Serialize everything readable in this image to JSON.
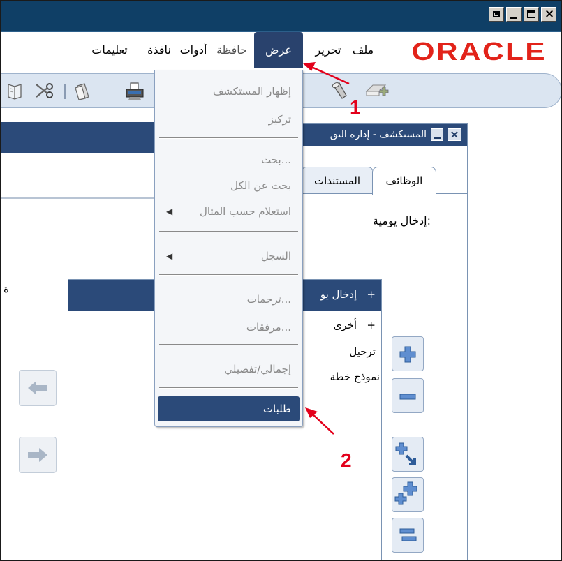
{
  "menubar": {
    "logo": "ORACLE",
    "items": [
      "ملف",
      "تحرير",
      "عرض",
      "حافظة",
      "أدوات",
      "نافذة",
      "تعليمات"
    ],
    "active": "عرض"
  },
  "dropdown": {
    "items": [
      {
        "label": "إظهار المستكشف"
      },
      {
        "label": "تركيز"
      },
      {
        "label": "بحث..."
      },
      {
        "label": "بحث عن الكل"
      },
      {
        "label": "استعلام حسب المثال"
      },
      {
        "label": "السجل"
      },
      {
        "label": "ترجمات..."
      },
      {
        "label": "مرفقات..."
      },
      {
        "label": "إجمالي/تفصيلي"
      },
      {
        "label": "طلبات"
      }
    ],
    "selected": "طلبات"
  },
  "dialog": {
    "title": "المستكشف - إدارة النق",
    "tabs": [
      "الوظائف",
      "المستندات"
    ],
    "label": "إدخال يومية:",
    "close_glyph": "×"
  },
  "list": {
    "rows": [
      {
        "prefix": "+",
        "text": "إدخال يو"
      },
      {
        "prefix": "+",
        "text": "أخرى"
      },
      {
        "prefix": "",
        "text": "ترحيل"
      },
      {
        "prefix": "",
        "text": "نموذج خطة"
      }
    ]
  },
  "left_fragment": "ة",
  "callouts": {
    "one": "1",
    "two": "2"
  },
  "window_controls": {
    "close_glyph": "×"
  },
  "icons": {
    "toolbar_left": [
      "open-book-icon",
      "scissors-icon",
      "separator",
      "documents-icon",
      "printer-icon"
    ],
    "toolbar_right": [
      "flashlight-icon",
      "new-record-icon"
    ],
    "side_buttons": [
      "plus-icon",
      "minus-icon",
      "expand-icon",
      "add-all-icon",
      "remove-all-icon"
    ],
    "nav_buttons": [
      "left-arrow-icon",
      "right-arrow-icon"
    ]
  },
  "colors": {
    "titlebar": "#0f3f66",
    "menu_active": "#29426d",
    "panel_header": "#2b4a79",
    "oracle_red": "#e2231a",
    "callout_red": "#e3001b"
  }
}
